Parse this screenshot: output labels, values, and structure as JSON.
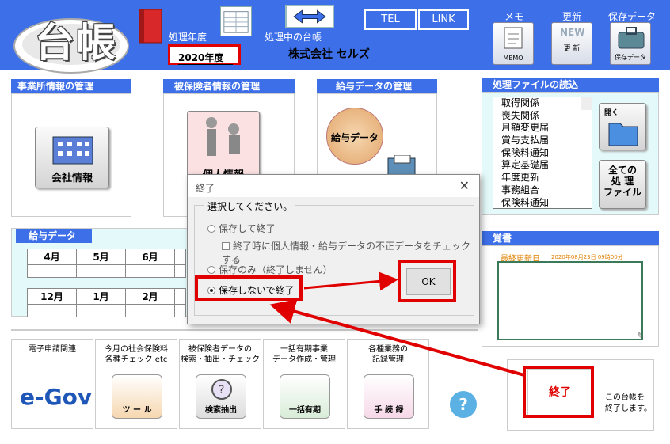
{
  "header": {
    "logo_text": "台帳",
    "year_label": "処理年度",
    "year_value": "2020年度",
    "current_ledger_label": "処理中の台帳",
    "company_name": "株式会社 セルズ",
    "tel_label": "TEL",
    "link_label": "LINK",
    "memo_label": "メモ",
    "memo_icon_caption": "MEMO",
    "update_label": "更新",
    "update_icon_caption": "更 新",
    "save_label": "保存データ",
    "save_icon_caption": "保存データ"
  },
  "sections": {
    "office_title": "事業所情報の管理",
    "office_button": "会社情報",
    "insured_title": "被保険者情報の管理",
    "insured_button": "個人情報",
    "salary_title": "給与データの管理",
    "salary_button": "給与データ",
    "files_title": "処理ファイルの読込",
    "open_label": "開く",
    "all_files_button": "全ての\n処 理\nファイル",
    "memo_title": "覚書",
    "last_updated_label": "最終更新日",
    "last_updated_value": "2020年08月23日 09時00分"
  },
  "file_list": [
    "取得関係",
    "喪失関係",
    "月額変更届",
    "賞与支払届",
    "保険料通知",
    "算定基礎届",
    "年度更新",
    "事務組合",
    "保険料通知"
  ],
  "salary_panel": {
    "title": "給与データ",
    "row1": [
      "4月",
      "5月",
      "6月",
      ""
    ],
    "row2": [
      "12月",
      "1月",
      "2月",
      ""
    ]
  },
  "tools": [
    {
      "title": "電子申請関連",
      "icon": "e-Gov"
    },
    {
      "title": "今月の社会保険料\n各種チェック etc",
      "icon": "ツ ー ル"
    },
    {
      "title": "被保険者データの\n検索・抽出・チェック",
      "icon": "検索抽出"
    },
    {
      "title": "一括有期事業\nデータ作成・管理",
      "icon": "一括有期"
    },
    {
      "title": "各種業務の\n記録管理",
      "icon": "手 続 録"
    }
  ],
  "end": {
    "button": "終了",
    "description": "この台帳を\n終了します。"
  },
  "dialog": {
    "title": "終了",
    "prompt": "選択してください。",
    "option1": "保存して終了",
    "check1": "終了時に個人情報・給与データの不正データをチェックする",
    "option2": "保存のみ（終了しません）",
    "option3": "保存しないで終了",
    "ok": "OK"
  }
}
